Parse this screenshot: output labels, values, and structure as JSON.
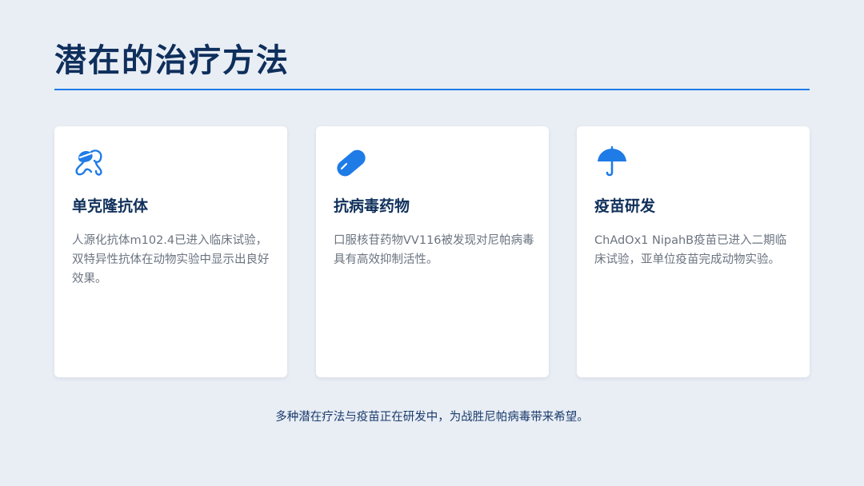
{
  "page": {
    "title": "潜在的治疗方法",
    "footer": "多种潜在疗法与疫苗正在研发中，为战胜尼帕病毒带来希望。"
  },
  "colors": {
    "accent": "#1f7be6",
    "title": "#0f2f5c",
    "background": "#e9eef5",
    "card": "#ffffff",
    "body_text": "#6b7480"
  },
  "cards": [
    {
      "icon": "antibody-icon",
      "heading": "单克隆抗体",
      "description": "人源化抗体m102.4已进入临床试验，双特异性抗体在动物实验中显示出良好效果。"
    },
    {
      "icon": "pill-icon",
      "heading": "抗病毒药物",
      "description": "口服核苷药物VV116被发现对尼帕病毒具有高效抑制活性。"
    },
    {
      "icon": "umbrella-icon",
      "heading": "疫苗研发",
      "description": "ChAdOx1 NipahB疫苗已进入二期临床试验，亚单位疫苗完成动物实验。"
    }
  ]
}
